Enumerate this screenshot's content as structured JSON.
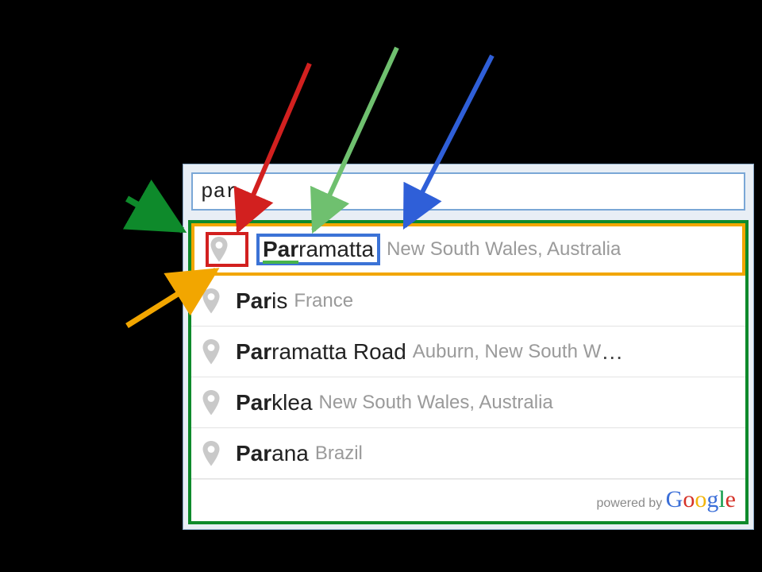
{
  "search": {
    "value": "par"
  },
  "suggestions": [
    {
      "matched_prefix": "Par",
      "matched_rest": "ramatta",
      "secondary": "New South Wales, Australia"
    },
    {
      "matched_prefix": "Par",
      "matched_rest": "is",
      "secondary": "France"
    },
    {
      "matched_prefix": "Par",
      "matched_rest": "ramatta Road",
      "secondary": "Auburn, New South W"
    },
    {
      "matched_prefix": "Par",
      "matched_rest": "klea",
      "secondary": "New South Wales, Australia"
    },
    {
      "matched_prefix": "Par",
      "matched_rest": "ana",
      "secondary": "Brazil"
    }
  ],
  "footer": {
    "prefix": "powered by ",
    "brand": {
      "c1": "G",
      "c2": "o",
      "c3": "o",
      "c4": "g",
      "c5": "l",
      "c6": "e"
    }
  },
  "overflow_ellipsis": "…"
}
